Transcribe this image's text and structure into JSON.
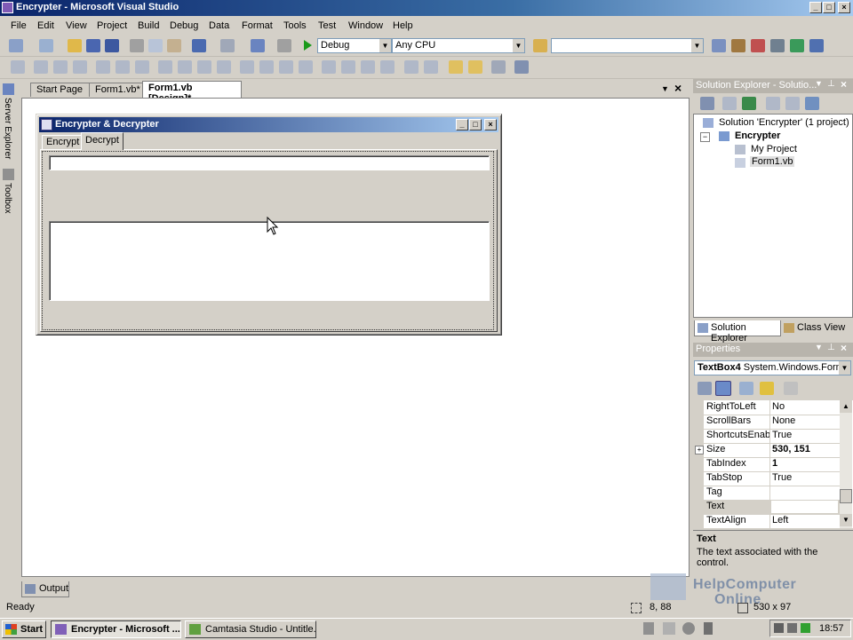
{
  "window": {
    "title": "Encrypter - Microsoft Visual Studio"
  },
  "menu": [
    "File",
    "Edit",
    "View",
    "Project",
    "Build",
    "Debug",
    "Data",
    "Format",
    "Tools",
    "Test",
    "Window",
    "Help"
  ],
  "toolbar": {
    "config": "Debug",
    "platform": "Any CPU",
    "find": ""
  },
  "left_strip": {
    "server_explorer": "Server Explorer",
    "toolbox": "Toolbox"
  },
  "doc_tabs": [
    "Start Page",
    "Form1.vb*",
    "Form1.vb [Design]*"
  ],
  "form": {
    "title": "Encrypter & Decrypter",
    "tabs": [
      "Encrypt",
      "Decrypt"
    ],
    "selected_tab": "Decrypt"
  },
  "solution_explorer": {
    "header": "Solution Explorer - Solutio...",
    "solution": "Solution 'Encrypter' (1 project)",
    "project": "Encrypter",
    "items": [
      "My Project",
      "Form1.vb"
    ],
    "tabs": [
      "Solution Explorer",
      "Class View"
    ]
  },
  "properties": {
    "header": "Properties",
    "object": "TextBox4",
    "object_type": "System.Windows.Forms",
    "rows": [
      {
        "name": "RightToLeft",
        "value": "No"
      },
      {
        "name": "ScrollBars",
        "value": "None"
      },
      {
        "name": "ShortcutsEnabled",
        "value": "True"
      },
      {
        "name": "Size",
        "value": "530, 151"
      },
      {
        "name": "TabIndex",
        "value": "1"
      },
      {
        "name": "TabStop",
        "value": "True"
      },
      {
        "name": "Tag",
        "value": ""
      },
      {
        "name": "Text",
        "value": ""
      },
      {
        "name": "TextAlign",
        "value": "Left"
      }
    ],
    "desc_title": "Text",
    "desc_body": "The text associated with the control."
  },
  "output_tab": "Output",
  "status": {
    "left": "Ready",
    "pos": "8, 88",
    "size": "530 x 97"
  },
  "watermark": {
    "line1": "HelpComputer",
    "line2": "Online"
  },
  "taskbar": {
    "start": "Start",
    "buttons": [
      "Encrypter - Microsoft ...",
      "Camtasia Studio - Untitle..."
    ],
    "clock": "18:57"
  }
}
